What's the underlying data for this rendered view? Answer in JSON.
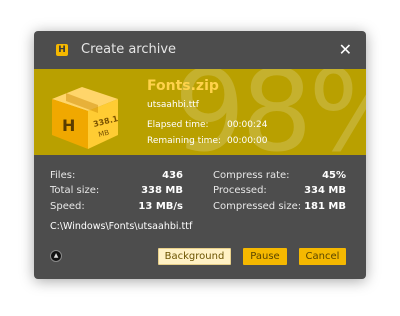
{
  "window": {
    "title": "Create archive",
    "app_icon_letter": "H",
    "close_glyph": "✕"
  },
  "banner": {
    "archive_name": "Fonts.zip",
    "current_file": "utsaahbi.ttf",
    "elapsed_label": "Elapsed time:",
    "elapsed_value": "00:00:24",
    "remaining_label": "Remaining time:",
    "remaining_value": "00:00:00",
    "percent_text": "98%",
    "progress_percent": 98,
    "box_letter": "H",
    "box_size_value": "338.1",
    "box_size_unit": "MB"
  },
  "stats": {
    "files_label": "Files:",
    "files_value": "436",
    "total_size_label": "Total size:",
    "total_size_value": "338 MB",
    "speed_label": "Speed:",
    "speed_value": "13 MB/s",
    "compress_rate_label": "Compress rate:",
    "compress_rate_value": "45%",
    "processed_label": "Processed:",
    "processed_value": "334 MB",
    "compressed_size_label": "Compressed size:",
    "compressed_size_value": "181 MB"
  },
  "path": "C:\\Windows\\Fonts\\utsaahbi.ttf",
  "buttons": {
    "background": "Background",
    "pause": "Pause",
    "cancel": "Cancel"
  },
  "colors": {
    "accent": "#f5b800",
    "banner": "#b9a000",
    "window_bg": "#4d4d4d",
    "archive_name": "#ffd24a"
  }
}
